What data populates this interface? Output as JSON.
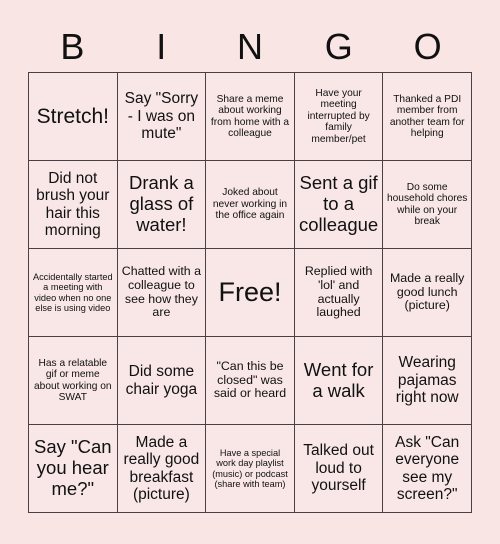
{
  "card": {
    "title_letters": [
      "B",
      "I",
      "N",
      "G",
      "O"
    ],
    "background_color": "#f8e5e4",
    "cell_color": "#f8e7e6",
    "border_color": "#4a3f45",
    "text_color": "#111111",
    "rows": 5,
    "columns": 5
  },
  "squares": [
    {
      "text": "Stretch!",
      "size": "s-xl"
    },
    {
      "text": "Say \"Sorry - I was on mute\"",
      "size": "s-md"
    },
    {
      "text": "Share a meme about working from home with a colleague",
      "size": "s-xs"
    },
    {
      "text": "Have your meeting interrupted by family member/pet",
      "size": "s-xs"
    },
    {
      "text": "Thanked a PDI member from another team for helping",
      "size": "s-xs"
    },
    {
      "text": "Did not brush your hair this morning",
      "size": "s-md"
    },
    {
      "text": "Drank a glass of water!",
      "size": "s-lg"
    },
    {
      "text": "Joked about never working in the office again",
      "size": "s-xs"
    },
    {
      "text": "Sent a gif to a colleague",
      "size": "s-lg"
    },
    {
      "text": "Do some household chores while on your break",
      "size": "s-xs"
    },
    {
      "text": "Accidentally started a meeting with video when no one else is using video",
      "size": "s-xxs"
    },
    {
      "text": "Chatted with a colleague to see how they are",
      "size": "s-sm"
    },
    {
      "text": "Free!",
      "size": "free"
    },
    {
      "text": "Replied with 'lol' and actually laughed",
      "size": "s-sm"
    },
    {
      "text": "Made a really good lunch (picture)",
      "size": "s-sm"
    },
    {
      "text": "Has a relatable gif or meme about working on SWAT",
      "size": "s-xs"
    },
    {
      "text": "Did some chair yoga",
      "size": "s-md"
    },
    {
      "text": "\"Can this be closed\" was said or heard",
      "size": "s-sm"
    },
    {
      "text": "Went for a walk",
      "size": "s-lg"
    },
    {
      "text": "Wearing pajamas right now",
      "size": "s-md"
    },
    {
      "text": "Say \"Can you hear me?\"",
      "size": "s-lg"
    },
    {
      "text": "Made a really good breakfast (picture)",
      "size": "s-md"
    },
    {
      "text": "Have a special work day playlist (music) or podcast (share with team)",
      "size": "s-xxs"
    },
    {
      "text": "Talked out loud to yourself",
      "size": "s-md"
    },
    {
      "text": "Ask \"Can everyone see my screen?\"",
      "size": "s-md"
    }
  ]
}
